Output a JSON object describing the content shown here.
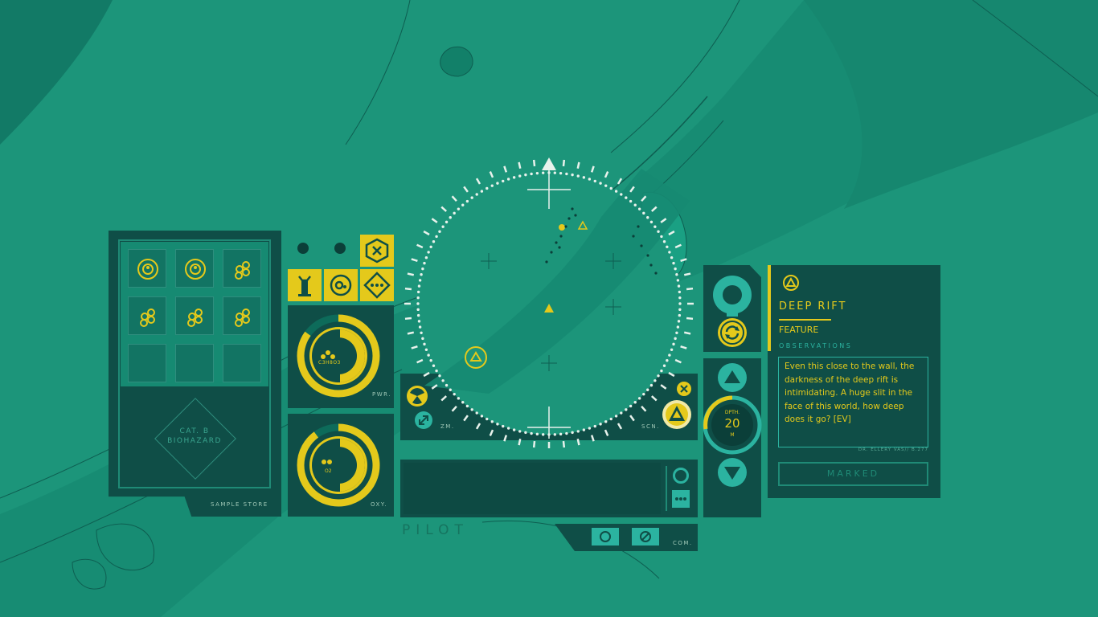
{
  "sample_store": {
    "label": "SAMPLE STORE",
    "hazard_line1": "CAT. B",
    "hazard_line2": "BIOHAZARD",
    "slots": [
      {
        "icon": "cell-icon"
      },
      {
        "icon": "cell-icon"
      },
      {
        "icon": "cluster-icon"
      },
      {
        "icon": "cluster-icon"
      },
      {
        "icon": "cluster-icon"
      },
      {
        "icon": "cluster-icon"
      },
      {
        "icon": "empty"
      },
      {
        "icon": "empty"
      },
      {
        "icon": "empty"
      }
    ]
  },
  "gauges": {
    "power": {
      "label": "PWR.",
      "compound": "C3H8O3",
      "level": 0.85
    },
    "oxygen": {
      "label": "OXY.",
      "compound": "O2",
      "level": 0.9
    }
  },
  "scanner": {
    "zoom_label": "ZM.",
    "scan_label": "SCN."
  },
  "pilot": {
    "label": "PILOT"
  },
  "comms": {
    "label": "COM."
  },
  "depth": {
    "label": "DPTH.",
    "value": "20",
    "unit": "M"
  },
  "info": {
    "title": "DEEP RIFT",
    "category": "FEATURE",
    "section": "OBSERVATIONS",
    "observation": "Even this close to the wall, the darkness of the deep rift is intimidating. A huge slit in the face of this world, how deep does it go? [EV]",
    "author": "DR. ELLERY VAS// B.277",
    "status_button": "MARKED"
  },
  "colors": {
    "accent": "#e4c91b",
    "panel": "#0f4e47",
    "water": "#1b9479"
  }
}
